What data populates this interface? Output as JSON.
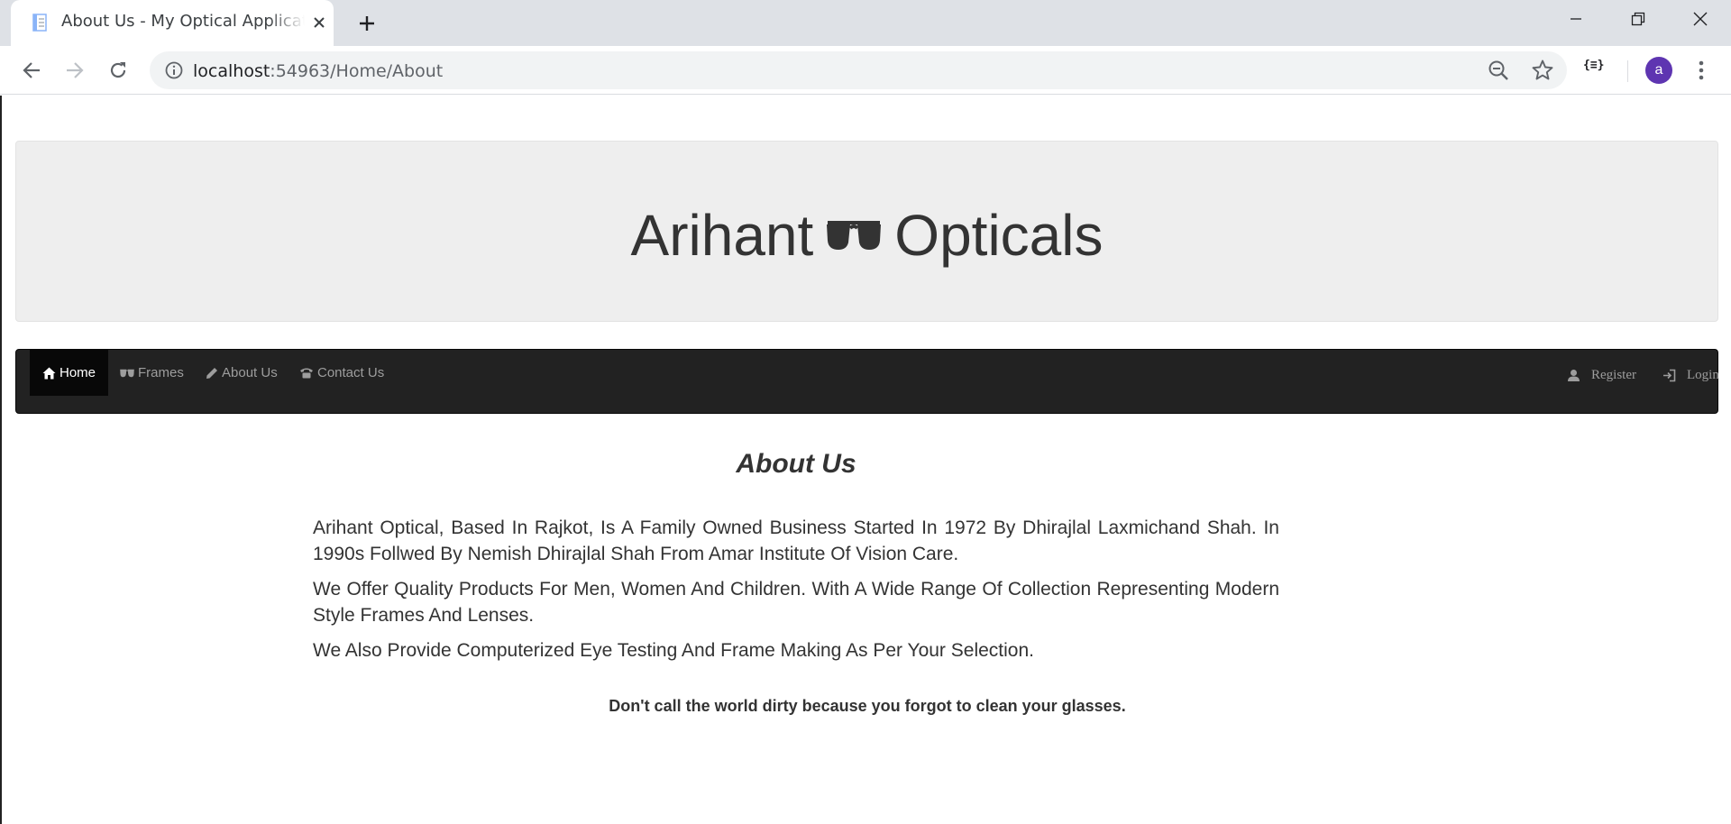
{
  "browser": {
    "tab_title": "About Us - My Optical Application",
    "url_host": "localhost",
    "url_rest": ":54963/Home/About",
    "extension_label": "{≡}",
    "profile_initial": "a"
  },
  "site": {
    "brand_left": "Arihant",
    "brand_right": "Opticals",
    "nav": {
      "items": [
        {
          "label": "Home",
          "icon": "home-icon",
          "active": true
        },
        {
          "label": "Frames",
          "icon": "glasses-icon"
        },
        {
          "label": "About Us",
          "icon": "pencil-icon"
        },
        {
          "label": "Contact Us",
          "icon": "phone-icon"
        }
      ],
      "right": [
        {
          "label": "Register",
          "icon": "user-icon"
        },
        {
          "label": "Login",
          "icon": "login-icon"
        }
      ]
    }
  },
  "content": {
    "title": "About Us",
    "paragraphs": [
      "Arihant Optical, Based In Rajkot, Is A Family Owned Business Started In 1972 By Dhirajlal Laxmichand Shah. In 1990s Follwed By Nemish Dhirajlal Shah From Amar Institute Of Vision Care.",
      "We Offer Quality Products For Men, Women And Children. With A Wide Range Of Collection Representing Modern Style Frames And Lenses.",
      "We Also Provide Computerized Eye Testing And Frame Making As Per Your Selection."
    ],
    "quote": "Don't call the world dirty because you forgot to clean your glasses."
  },
  "colors": {
    "navbar_bg": "#222222",
    "navbar_active": "#080808",
    "jumbotron_bg": "#eeeeee",
    "avatar": "#5e35b1"
  }
}
